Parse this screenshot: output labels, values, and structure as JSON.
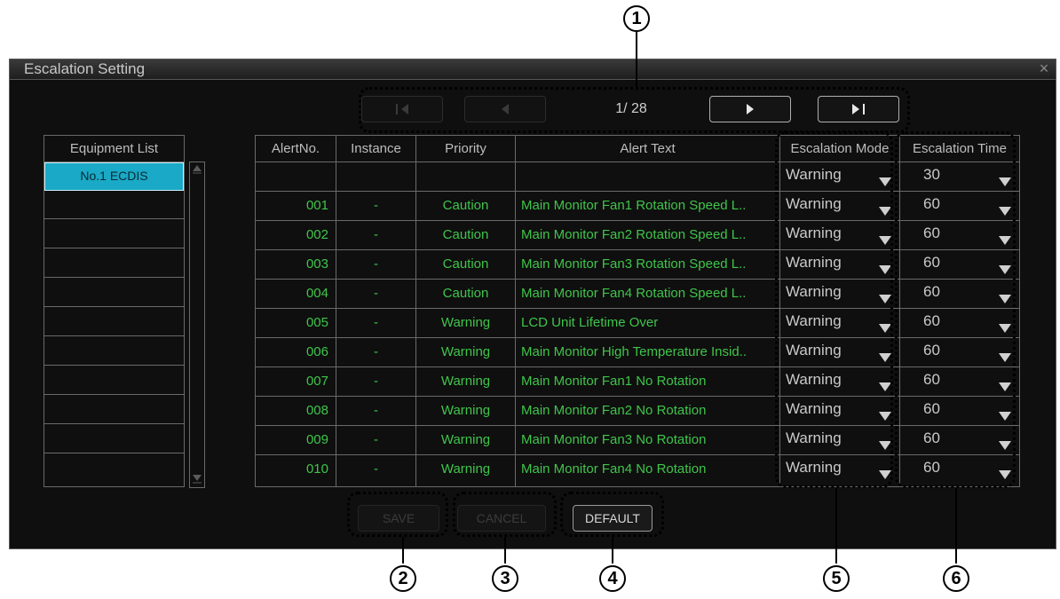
{
  "window": {
    "title": "Escalation Setting",
    "close_glyph": "×"
  },
  "pager": {
    "page": "1/ 28"
  },
  "equipment": {
    "header": "Equipment List",
    "items": [
      "No.1 ECDIS",
      "",
      "",
      "",
      "",
      "",
      "",
      "",
      "",
      "",
      ""
    ]
  },
  "table": {
    "headers": {
      "alert_no": "AlertNo.",
      "instance": "Instance",
      "priority": "Priority",
      "alert_text": "Alert Text",
      "mode": "Escalation Mode",
      "time": "Escalation Time"
    },
    "rows": [
      {
        "no": "",
        "instance": "",
        "priority": "",
        "text": "",
        "mode": "Warning",
        "time": "30"
      },
      {
        "no": "001",
        "instance": "-",
        "priority": "Caution",
        "text": "Main Monitor Fan1 Rotation Speed L..",
        "mode": "Warning",
        "time": "60"
      },
      {
        "no": "002",
        "instance": "-",
        "priority": "Caution",
        "text": "Main Monitor Fan2 Rotation Speed L..",
        "mode": "Warning",
        "time": "60"
      },
      {
        "no": "003",
        "instance": "-",
        "priority": "Caution",
        "text": "Main Monitor Fan3 Rotation Speed L..",
        "mode": "Warning",
        "time": "60"
      },
      {
        "no": "004",
        "instance": "-",
        "priority": "Caution",
        "text": "Main Monitor Fan4 Rotation Speed L..",
        "mode": "Warning",
        "time": "60"
      },
      {
        "no": "005",
        "instance": "-",
        "priority": "Warning",
        "text": "LCD Unit Lifetime Over",
        "mode": "Warning",
        "time": "60"
      },
      {
        "no": "006",
        "instance": "-",
        "priority": "Warning",
        "text": "Main Monitor High Temperature Insid..",
        "mode": "Warning",
        "time": "60"
      },
      {
        "no": "007",
        "instance": "-",
        "priority": "Warning",
        "text": "Main Monitor Fan1 No Rotation",
        "mode": "Warning",
        "time": "60"
      },
      {
        "no": "008",
        "instance": "-",
        "priority": "Warning",
        "text": "Main Monitor Fan2 No Rotation",
        "mode": "Warning",
        "time": "60"
      },
      {
        "no": "009",
        "instance": "-",
        "priority": "Warning",
        "text": "Main Monitor Fan3 No Rotation",
        "mode": "Warning",
        "time": "60"
      },
      {
        "no": "010",
        "instance": "-",
        "priority": "Warning",
        "text": "Main Monitor Fan4 No Rotation",
        "mode": "Warning",
        "time": "60"
      }
    ]
  },
  "buttons": {
    "save": "SAVE",
    "cancel": "CANCEL",
    "default": "DEFAULT"
  },
  "callouts": [
    "1",
    "2",
    "3",
    "4",
    "5",
    "6"
  ],
  "icons": {
    "first": "first-page-icon",
    "prev": "prev-page-icon",
    "next": "next-page-icon",
    "last": "last-page-icon",
    "dropdown": "dropdown-arrow-icon",
    "close": "close-icon"
  },
  "colors": {
    "window_bg": "#0f0f0f",
    "alert_text": "#3fc54a",
    "selection": "#1aa9c6",
    "header_text": "#bdbdbd"
  }
}
